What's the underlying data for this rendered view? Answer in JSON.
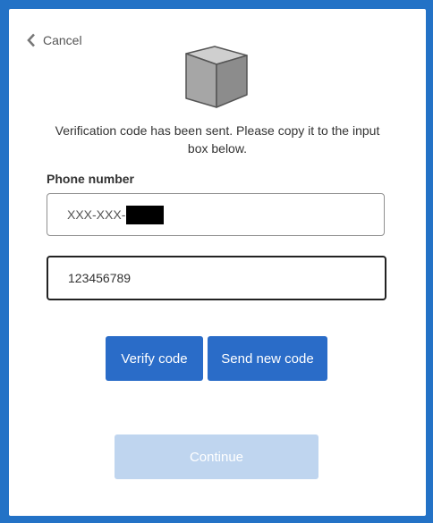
{
  "header": {
    "cancel_label": "Cancel",
    "back_icon": "chevron-left-icon",
    "logo_icon": "cube-icon"
  },
  "message": "Verification code has been sent. Please copy it to the input box below.",
  "phone": {
    "label": "Phone number",
    "value_prefix": "XXX-XXX-"
  },
  "code_input": {
    "value": "123456789"
  },
  "buttons": {
    "verify_label": "Verify code",
    "send_label": "Send new code",
    "continue_label": "Continue"
  },
  "colors": {
    "background": "#2372c6",
    "primary_button": "#2a6cc8",
    "disabled_button": "#bfd5ef"
  }
}
